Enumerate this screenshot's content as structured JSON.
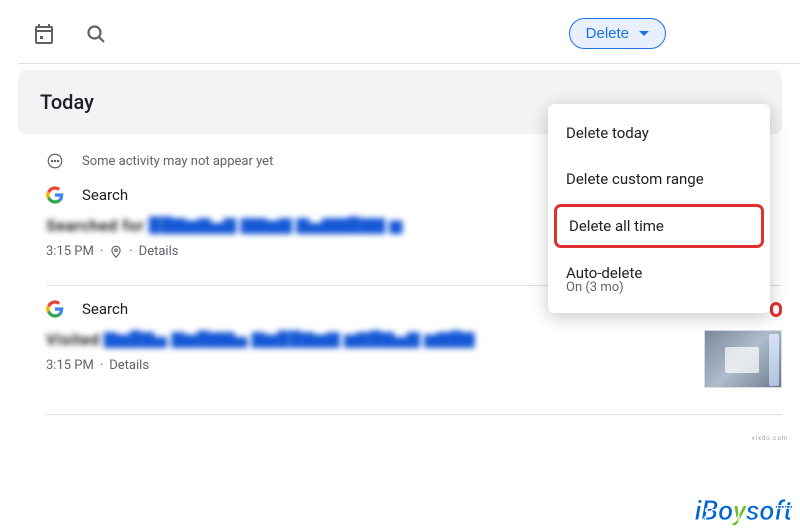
{
  "toolbar": {
    "delete_label": "Delete"
  },
  "section_header": "Today",
  "notice_text": "Some activity may not appear yet",
  "dropdown": {
    "items": [
      {
        "label": "Delete today"
      },
      {
        "label": "Delete custom range"
      },
      {
        "label": "Delete all time"
      },
      {
        "label": "Auto-delete",
        "sub": "On (3 mo)"
      }
    ]
  },
  "activities": [
    {
      "service": "Search",
      "title_blur": "Searched for █████████████████",
      "time": "3:15 PM",
      "details_label": "Details",
      "has_location": true,
      "has_close": false,
      "has_thumb": false
    },
    {
      "service": "Search",
      "title_blur": "Visited ████████████████████████████",
      "time": "3:15 PM",
      "details_label": "Details",
      "has_location": false,
      "has_close": true,
      "has_thumb": true
    }
  ],
  "watermark_small": "vixdn.com",
  "watermark_large": {
    "part1": "iBo",
    "part2": "y",
    "part3": "soft"
  }
}
